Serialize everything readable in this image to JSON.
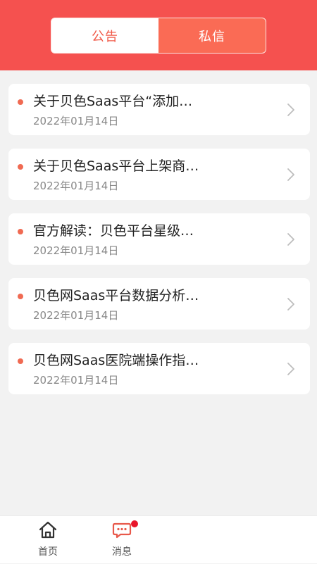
{
  "header": {
    "tabs": [
      {
        "label": "公告"
      },
      {
        "label": "私信"
      }
    ]
  },
  "list": [
    {
      "title": "关于贝色Saas平台“添加…",
      "date": "2022年01月14日"
    },
    {
      "title": "关于贝色Saas平台上架商…",
      "date": "2022年01月14日"
    },
    {
      "title": "官方解读：贝色平台星级…",
      "date": "2022年01月14日"
    },
    {
      "title": "贝色网Saas平台数据分析…",
      "date": "2022年01月14日"
    },
    {
      "title": "贝色网Saas医院端操作指…",
      "date": "2022年01月14日"
    }
  ],
  "tabbar": {
    "home_label": "首页",
    "messages_label": "消息"
  },
  "colors": {
    "header": "#f5514f",
    "active_tab": "#fa6b55",
    "dot": "#f06a52",
    "badge": "#e8152a",
    "msg_icon": "#e8584a"
  },
  "icons": {
    "home": "home-icon",
    "messages": "chat-bubble-icon",
    "chevron": "chevron-right-icon"
  }
}
